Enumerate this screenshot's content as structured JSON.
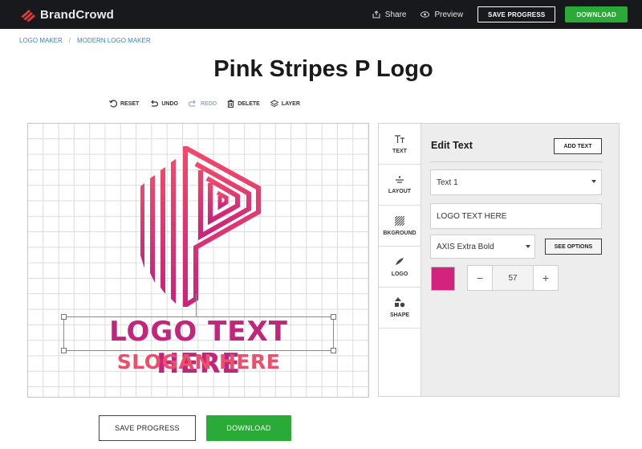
{
  "colors": {
    "topbar_bg": "#17191c",
    "accent_green": "#2aaa37",
    "brand_red": "#e63b3b",
    "logo_pink": "#c2267c",
    "slogan_pink": "#ec4f6c",
    "swatch": "#d4237f",
    "link_blue": "#3a86c8"
  },
  "header": {
    "brand": "BrandCrowd",
    "share_label": "Share",
    "share_icon": "share-icon",
    "preview_label": "Preview",
    "preview_icon": "eye-icon",
    "save_progress_label": "SAVE PROGRESS",
    "download_label": "DOWNLOAD"
  },
  "breadcrumb": {
    "items": [
      "LOGO MAKER",
      "MODERN LOGO MAKER"
    ],
    "separator": "/"
  },
  "page_title": "Pink Stripes P Logo",
  "toolbar": {
    "reset": "RESET",
    "undo": "UNDO",
    "redo": "REDO",
    "delete": "DELETE",
    "layer": "LAYER"
  },
  "canvas": {
    "logo_text": "LOGO TEXT HERE",
    "slogan_text": "SLOGAN HERE"
  },
  "panel": {
    "tabs": [
      {
        "label": "TEXT",
        "icon": "text-icon"
      },
      {
        "label": "LAYOUT",
        "icon": "layout-icon"
      },
      {
        "label": "BKGROUND",
        "icon": "background-icon"
      },
      {
        "label": "LOGO",
        "icon": "logo-icon"
      },
      {
        "label": "SHAPE",
        "icon": "shape-icon"
      }
    ],
    "title": "Edit Text",
    "add_text_label": "ADD TEXT",
    "text_select_value": "Text 1",
    "text_input_value": "LOGO TEXT HERE",
    "font_select_value": "AXIS Extra Bold",
    "see_options_label": "SEE OPTIONS",
    "size_value": "57",
    "minus_label": "−",
    "plus_label": "+"
  },
  "footer": {
    "save_progress_label": "SAVE PROGRESS",
    "download_label": "DOWNLOAD"
  }
}
